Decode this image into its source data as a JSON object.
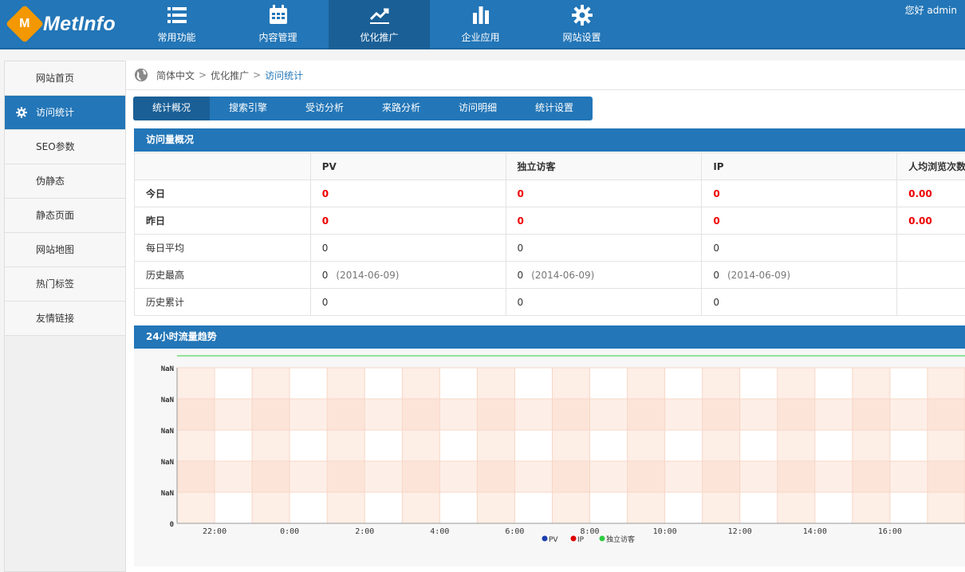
{
  "brand": {
    "logo_letter": "M",
    "name": "MetInfo"
  },
  "user": {
    "greeting": "您好 admin"
  },
  "nav": [
    {
      "label": "常用功能",
      "icon": "list-icon"
    },
    {
      "label": "内容管理",
      "icon": "calendar-icon"
    },
    {
      "label": "优化推广",
      "icon": "trend-icon",
      "active": true
    },
    {
      "label": "企业应用",
      "icon": "bar-chart-icon"
    },
    {
      "label": "网站设置",
      "icon": "gear-icon"
    }
  ],
  "sidebar": [
    {
      "label": "网站首页"
    },
    {
      "label": "访问统计",
      "active": true,
      "icon": "gear-icon"
    },
    {
      "label": "SEO参数"
    },
    {
      "label": "伪静态"
    },
    {
      "label": "静态页面"
    },
    {
      "label": "网站地图"
    },
    {
      "label": "热门标签"
    },
    {
      "label": "友情链接"
    }
  ],
  "breadcrumb": {
    "lang": "简体中文",
    "sep": ">",
    "section": "优化推广",
    "current": "访问统计"
  },
  "tabs": [
    "统计概况",
    "搜索引擎",
    "受访分析",
    "来路分析",
    "访问明细",
    "统计设置"
  ],
  "overview": {
    "title": "访问量概况",
    "headers": [
      "",
      "PV",
      "独立访客",
      "IP",
      "人均浏览次数"
    ],
    "rows": [
      {
        "label": "今日",
        "pv": "0",
        "uv": "0",
        "ip": "0",
        "avg": "0.00",
        "highlight": true
      },
      {
        "label": "昨日",
        "pv": "0",
        "uv": "0",
        "ip": "0",
        "avg": "0.00",
        "highlight": true
      },
      {
        "label": "每日平均",
        "pv": "0",
        "uv": "0",
        "ip": "0",
        "avg": ""
      },
      {
        "label": "历史最高",
        "pv": "0",
        "uv": "0",
        "ip": "0",
        "avg": "",
        "date": "(2014-06-09)"
      },
      {
        "label": "历史累计",
        "pv": "0",
        "uv": "0",
        "ip": "0",
        "avg": ""
      }
    ]
  },
  "trend": {
    "title": "24小时流量趋势"
  },
  "chart_data": {
    "type": "line",
    "x": [
      "22:00",
      "0:00",
      "2:00",
      "4:00",
      "6:00",
      "8:00",
      "10:00",
      "12:00",
      "14:00",
      "16:00"
    ],
    "y_tick_labels": [
      "0",
      "NaN",
      "NaN",
      "NaN",
      "NaN",
      "NaN"
    ],
    "series": [
      {
        "name": "PV",
        "color": "#1b3fae"
      },
      {
        "name": "IP",
        "color": "#e00000"
      },
      {
        "name": "独立访客",
        "color": "#2ecc40"
      }
    ],
    "legend": "bottom-center",
    "grid": true
  }
}
